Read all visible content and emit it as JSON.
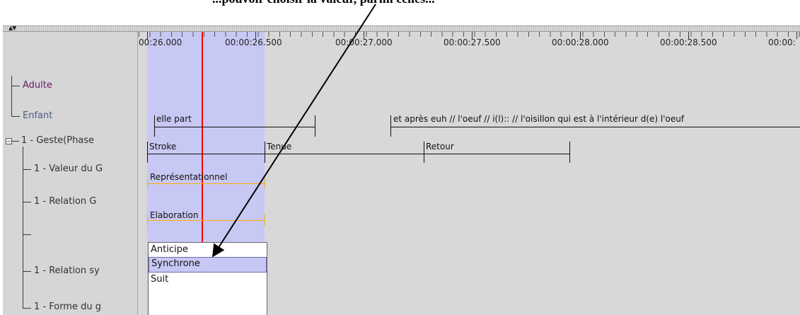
{
  "caption": "...pouvoir choisir la valeur, parmi celles...",
  "ruler": {
    "ticks": [
      "00:26.000",
      "00:00:26.500",
      "00:00:27.000",
      "00:00:27.500",
      "00:00:28.000",
      "00:00:28.500",
      "00:00:"
    ]
  },
  "tiers": {
    "adulte": "Adulte",
    "enfant": "Enfant",
    "geste": "1 - Geste(Phase",
    "valeur": "1 - Valeur du G",
    "relation_g": "1 - Relation G",
    "relation_sy": "1 - Relation sy",
    "forme": "1 - Forme du g"
  },
  "annotations": {
    "enfant_1": "elle part",
    "enfant_2": "et après euh // l'oeuf // i(l):: // l'oisillon qui est à l'intérieur d(e) l'oeuf",
    "stroke": "Stroke",
    "tenue": "Tenue",
    "retour": "Retour",
    "valeur": "Représentationnel",
    "relation": "Elaboration"
  },
  "dropdown": {
    "options": [
      "Anticipe",
      "Synchrone",
      "Suit"
    ],
    "selected": "Synchrone"
  },
  "colors": {
    "selection": "#c8c8f4",
    "crosshair": "#ff0000",
    "adulte_label": "#6a1a6a",
    "enfant_label": "#4a5a8a",
    "orange": "#ffb000"
  }
}
